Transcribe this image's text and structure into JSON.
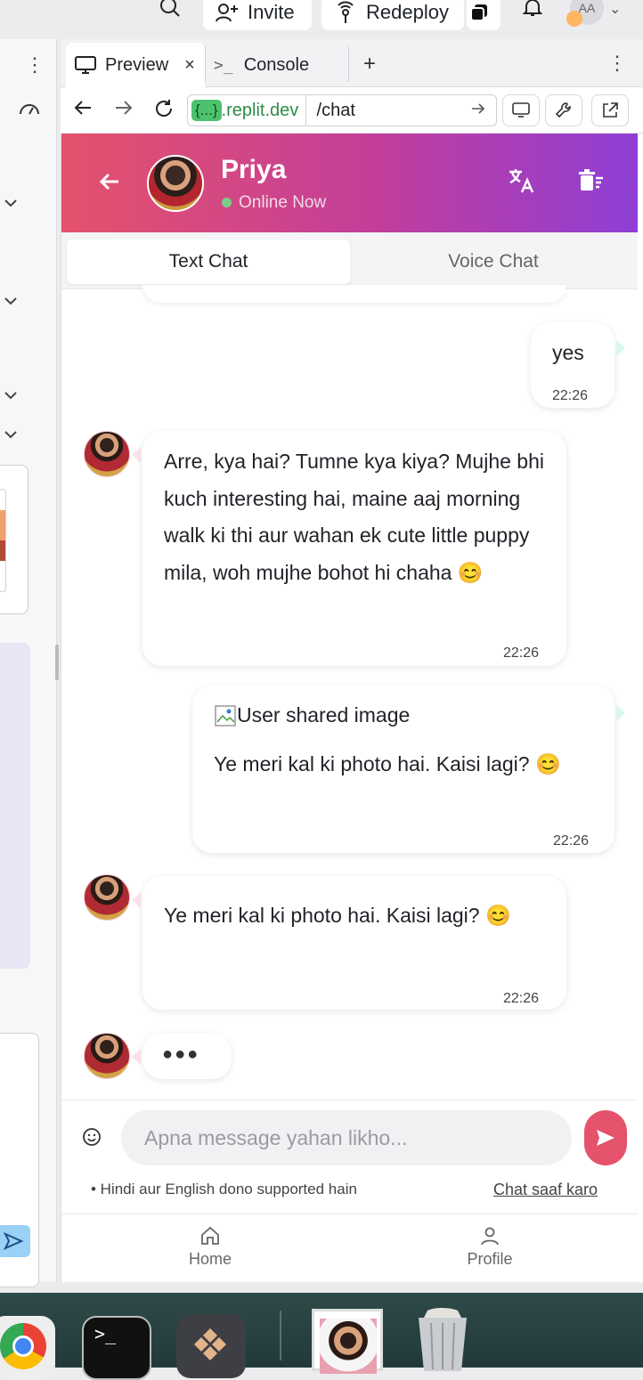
{
  "topbar": {
    "invite_label": "Invite",
    "redeploy_label": "Redeploy",
    "avatar_initials": "AA"
  },
  "tabs": {
    "preview_label": "Preview",
    "console_label": "Console",
    "console_glyph": ">_",
    "add_glyph": "+",
    "close_glyph": "×"
  },
  "urlbar": {
    "host_badge": "{...}",
    "host": ".replit.dev",
    "path": "/chat"
  },
  "header": {
    "name": "Priya",
    "status": "Online Now"
  },
  "chat_tabs": {
    "text_chat": "Text Chat",
    "voice_chat": "Voice Chat"
  },
  "messages": [
    {
      "from": "user",
      "text": "yes",
      "time": "22:26"
    },
    {
      "from": "bot",
      "text": "Arre, kya hai? Tumne kya kiya? Mujhe bhi kuch interesting hai, maine aaj morning walk ki thi aur wahan ek cute little puppy mila, woh mujhe bohot hi chaha 😊",
      "time": "22:26"
    },
    {
      "from": "user",
      "image_alt": "User shared image",
      "text": "Ye meri kal ki photo hai. Kaisi lagi? 😊",
      "time": "22:26"
    },
    {
      "from": "bot",
      "text": "Ye meri kal ki photo hai. Kaisi lagi? 😊",
      "time": "22:26"
    }
  ],
  "typing_indicator": "●●●",
  "composer": {
    "placeholder": "Apna message yahan likho...",
    "hint": "• Hindi aur English dono supported hain",
    "clear_label": "Chat saaf karo"
  },
  "bottom_nav": {
    "home": "Home",
    "profile": "Profile"
  },
  "colors": {
    "gradient_start": "#e5526b",
    "gradient_end": "#8e3fd6",
    "online_dot": "#7ad08a",
    "send_button": "#e5526b"
  }
}
